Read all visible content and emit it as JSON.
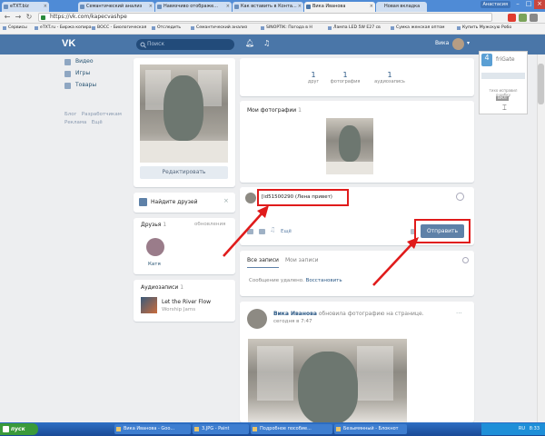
{
  "browser": {
    "tabs": [
      {
        "label": "eTXT.biz"
      },
      {
        "label": "Семантический анализ"
      },
      {
        "label": "Навязчиво отображе..."
      },
      {
        "label": "Как вставить в Конта..."
      },
      {
        "label": "Вика Иванова"
      },
      {
        "label": "Новая вкладка"
      }
    ],
    "window_user": "Анастасия",
    "url": "https://vk.com/kapecvashpe",
    "bookmarks": [
      "Сервисы",
      "eTXT.ru - Биржа копира",
      "ВОСС - Биологическая",
      "Отследить",
      "Семантический анализ",
      "SINOPTIK: Погода в Н",
      "Лампа LED 5W E27 св",
      "Сумка женская оптом",
      "Купить Мужскую Робо"
    ]
  },
  "vk_header": {
    "logo": "VK",
    "search_placeholder": "Поиск",
    "user_name": "Вика"
  },
  "left_menu": {
    "items": [
      {
        "label": "Видео"
      },
      {
        "label": "Игры"
      },
      {
        "label": "Товары"
      }
    ],
    "footer_links": [
      "Блог",
      "Разработчикам",
      "Реклама",
      "Ещё"
    ]
  },
  "profile": {
    "edit_button": "Редактировать",
    "find_friends": "Найдите друзей",
    "friends_title": "Друзья",
    "friends_count": "1",
    "friends_updates": "обновления",
    "friend_name": "Катя",
    "audio_title": "Аудиозаписи",
    "audio_count": "1",
    "track_title": "Let the River Flow",
    "track_artist": "Worship Jams"
  },
  "counters": [
    {
      "value": "1",
      "label": "друг"
    },
    {
      "value": "1",
      "label": "фотография"
    },
    {
      "value": "1",
      "label": "аудиозапись"
    }
  ],
  "my_photos": {
    "title": "Мои фотографии",
    "count": "1"
  },
  "post_box": {
    "text": "[id51500290 (Лена привет)",
    "more": "Ещё",
    "send": "Отправить"
  },
  "wall": {
    "tab_all": "Все записи",
    "tab_mine": "Мои записи",
    "deleted_msg": "Сообщение удалено.",
    "restore": "Восстановить"
  },
  "feed_post": {
    "author": "Вика Иванова",
    "action": "обновила фотографию на странице.",
    "time": "сегодня в 7:47",
    "more_dots": "···"
  },
  "frigate": {
    "label": "friGate",
    "line1": "тихо исправил ошибку",
    "line2": "ВКЛ"
  },
  "taskbar": {
    "start": "пуск",
    "items": [
      "Вика Иванова - Goo...",
      "3.JPG - Paint",
      "Подробное пособие...",
      "Безымянный - Блокнот"
    ],
    "lang": "RU",
    "clock": "8:33"
  },
  "colors": {
    "vk_blue": "#4a76a8",
    "annotation_red": "#e01b1b",
    "send_button": "#5e81a8"
  }
}
